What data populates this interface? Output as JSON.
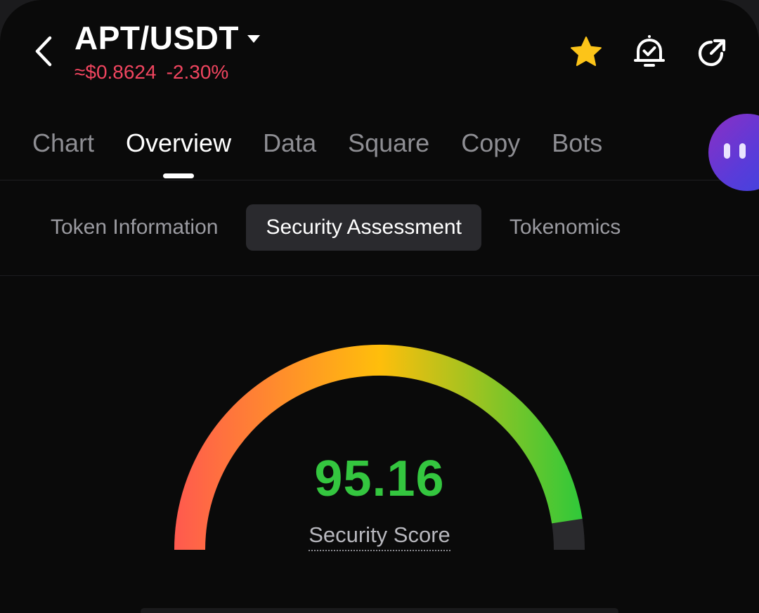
{
  "header": {
    "pair": "APT/USDT",
    "price": "≈$0.8624",
    "change": "-2.30%",
    "icons": {
      "back": "chevron-left-icon",
      "dropdown": "caret-down-icon",
      "favorite": "star-icon",
      "alert": "bell-check-icon",
      "share": "share-arrow-icon"
    },
    "colors": {
      "price": "#f0455f",
      "favorite": "#fcc419"
    }
  },
  "main_tabs": [
    {
      "label": "Chart",
      "active": false
    },
    {
      "label": "Overview",
      "active": true
    },
    {
      "label": "Data",
      "active": false
    },
    {
      "label": "Square",
      "active": false
    },
    {
      "label": "Copy",
      "active": false
    },
    {
      "label": "Bots",
      "active": false
    }
  ],
  "sub_tabs": [
    {
      "label": "Token Information",
      "active": false
    },
    {
      "label": "Security Assessment",
      "active": true
    },
    {
      "label": "Tokenomics",
      "active": false
    }
  ],
  "security": {
    "score": "95.16",
    "score_value": 95.16,
    "score_max": 100,
    "label": "Security Score",
    "score_color": "#34c63f",
    "gradient": [
      "#ff5a4e",
      "#ffbe0b",
      "#2ec93a"
    ],
    "track_color": "#2a2a2d"
  }
}
